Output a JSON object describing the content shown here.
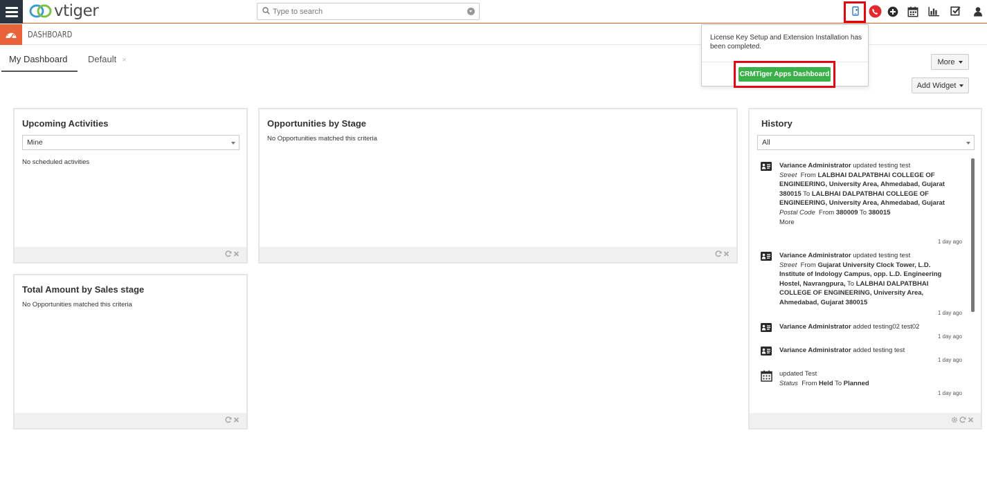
{
  "header": {
    "logo_text": "vtiger",
    "search": {
      "placeholder": "Type to search",
      "value": ""
    }
  },
  "module": {
    "title": "DASHBOARD"
  },
  "tabs": [
    {
      "label": "My Dashboard"
    },
    {
      "label": "Default",
      "close": "×"
    }
  ],
  "actions": {
    "more_label": "More",
    "add_widget_label": "Add Widget"
  },
  "widgets": {
    "upcoming": {
      "title": "Upcoming Activities",
      "filter": "Mine",
      "empty": "No scheduled activities"
    },
    "opportunities": {
      "title": "Opportunities by Stage",
      "empty": "No Opportunities matched this criteria"
    },
    "total_amount": {
      "title": "Total Amount by Sales stage",
      "empty": "No Opportunities matched this criteria"
    },
    "history": {
      "title": "History",
      "filter": "All",
      "items": [
        {
          "user": "Variance Administrator",
          "action": "updated testing test",
          "field1": "Street",
          "from1": "From",
          "from1_value": "LALBHAI DALPATBHAI COLLEGE OF ENGINEERING, University Area, Ahmedabad, Gujarat 380015",
          "to1": "To",
          "to1_value": "LALBHAI DALPATBHAI COLLEGE OF ENGINEERING, University Area, Ahmedabad, Gujarat",
          "field2": "Postal Code",
          "from2": "From",
          "from2_value": "380009",
          "to2": "To",
          "to2_value": "380015",
          "more": "More",
          "time": "1 day ago"
        },
        {
          "user": "Variance Administrator",
          "action": "updated testing test",
          "field1": "Street",
          "from1": "From",
          "from1_value": "Gujarat University Clock Tower, L.D. Institute of Indology Campus, opp. L.D. Engineering Hostel, Navrangpura,",
          "to1": "To",
          "to1_value": "LALBHAI DALPATBHAI COLLEGE OF ENGINEERING, University Area, Ahmedabad, Gujarat 380015",
          "time": "1 day ago"
        },
        {
          "user": "Variance Administrator",
          "action": "added testing02 test02",
          "time": "1 day ago"
        },
        {
          "user": "Variance Administrator",
          "action": "added testing test",
          "time": "1 day ago"
        },
        {
          "action": "updated Test",
          "field1": "Status",
          "from1": "From",
          "from1_value": "Held",
          "to1": "To",
          "to1_value": "Planned",
          "time": "1 day ago"
        }
      ]
    }
  },
  "popup": {
    "message": "License Key Setup and Extension Installation has been completed.",
    "button_label": "CRMTiger Apps Dashboard"
  },
  "colors": {
    "accent_orange": "#e8623a",
    "menu_dark": "#2a3441",
    "button_green": "#3ab049",
    "highlight_red": "#e30613"
  },
  "icons": {
    "top_bar": [
      "extension-icon",
      "phone-icon",
      "add-icon",
      "calendar-icon",
      "reports-icon",
      "tasks-icon",
      "user-icon"
    ]
  }
}
